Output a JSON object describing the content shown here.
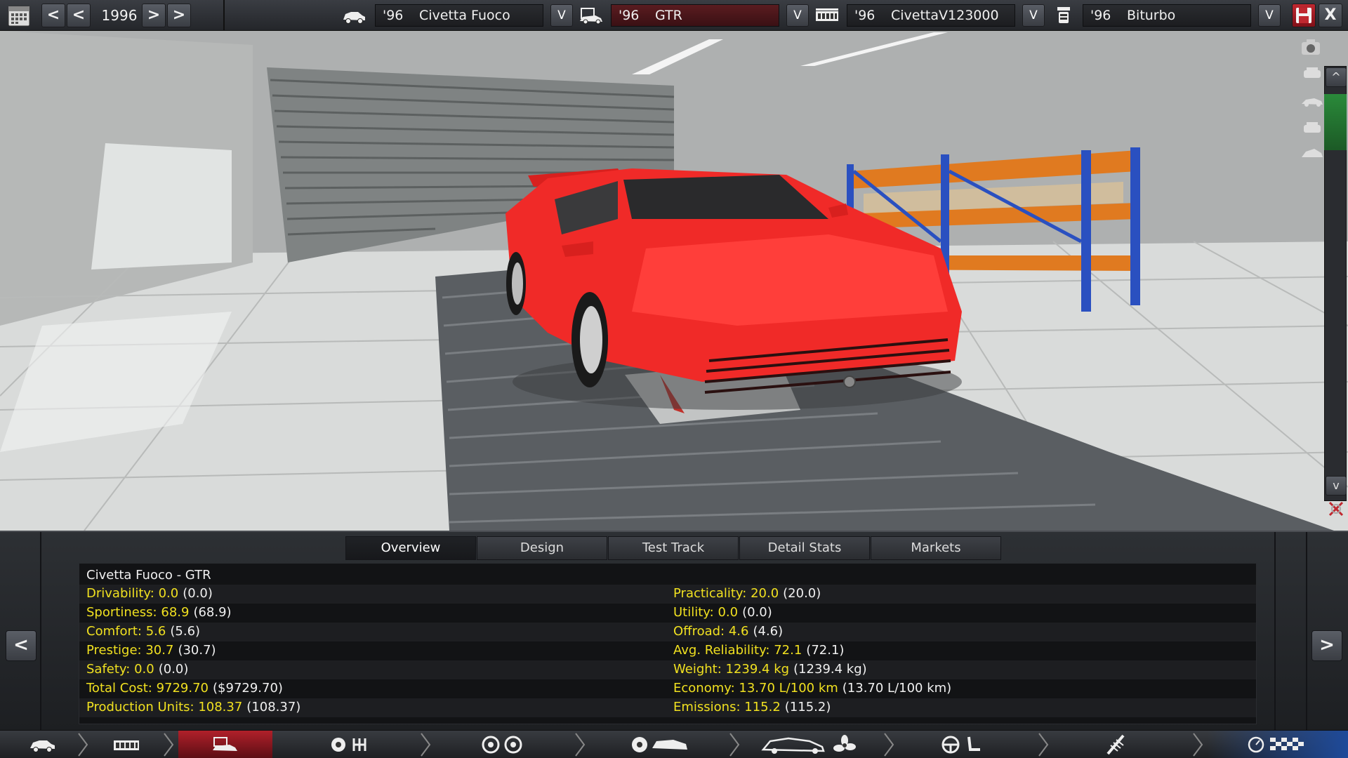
{
  "topbar": {
    "year": "1996",
    "prev_fast": "<",
    "prev": "<",
    "next": ">",
    "next_fast": ">",
    "dropdown_glyph": "V",
    "model": {
      "year": "'96",
      "name": "Civetta Fuoco"
    },
    "trim": {
      "year": "'96",
      "name": "GTR"
    },
    "engine": {
      "year": "'96",
      "name": "CivettaV123000"
    },
    "engine_variant": {
      "year": "'96",
      "name": "Biturbo"
    },
    "close": "X"
  },
  "side": {
    "up": "^",
    "down": "v"
  },
  "panel": {
    "tabs": [
      "Overview",
      "Design",
      "Test Track",
      "Detail Stats",
      "Markets"
    ],
    "active_tab": "Overview",
    "title": "Civetta Fuoco - GTR",
    "left_stats": [
      {
        "label": "Drivability:",
        "value": "0.0",
        "paren": "(0.0)"
      },
      {
        "label": "Sportiness:",
        "value": "68.9",
        "paren": "(68.9)"
      },
      {
        "label": "Comfort:",
        "value": "5.6",
        "paren": "(5.6)"
      },
      {
        "label": "Prestige:",
        "value": "30.7",
        "paren": "(30.7)"
      },
      {
        "label": "Safety:",
        "value": "0.0",
        "paren": "(0.0)"
      },
      {
        "label": "Total Cost:",
        "value": "9729.70",
        "paren": "($9729.70)"
      },
      {
        "label": "Production Units:",
        "value": "108.37",
        "paren": "(108.37)"
      }
    ],
    "right_stats": [
      {
        "label": "Practicality:",
        "value": "20.0",
        "paren": "(20.0)"
      },
      {
        "label": "Utility:",
        "value": "0.0",
        "paren": "(0.0)"
      },
      {
        "label": "Offroad:",
        "value": "4.6",
        "paren": "(4.6)"
      },
      {
        "label": "Avg. Reliability:",
        "value": "72.1",
        "paren": "(72.1)"
      },
      {
        "label": "Weight:",
        "value": "1239.4 kg",
        "paren": "(1239.4 kg)"
      },
      {
        "label": "Economy:",
        "value": "13.70 L/100 km",
        "paren": "(13.70 L/100 km)"
      },
      {
        "label": "Emissions:",
        "value": "115.2",
        "paren": "(115.2)"
      }
    ],
    "nav_prev": "<",
    "nav_next": ">"
  },
  "colors": {
    "stat_yellow": "#f0e020",
    "accent_red": "#b0202a",
    "car_red": "#f02a28"
  }
}
